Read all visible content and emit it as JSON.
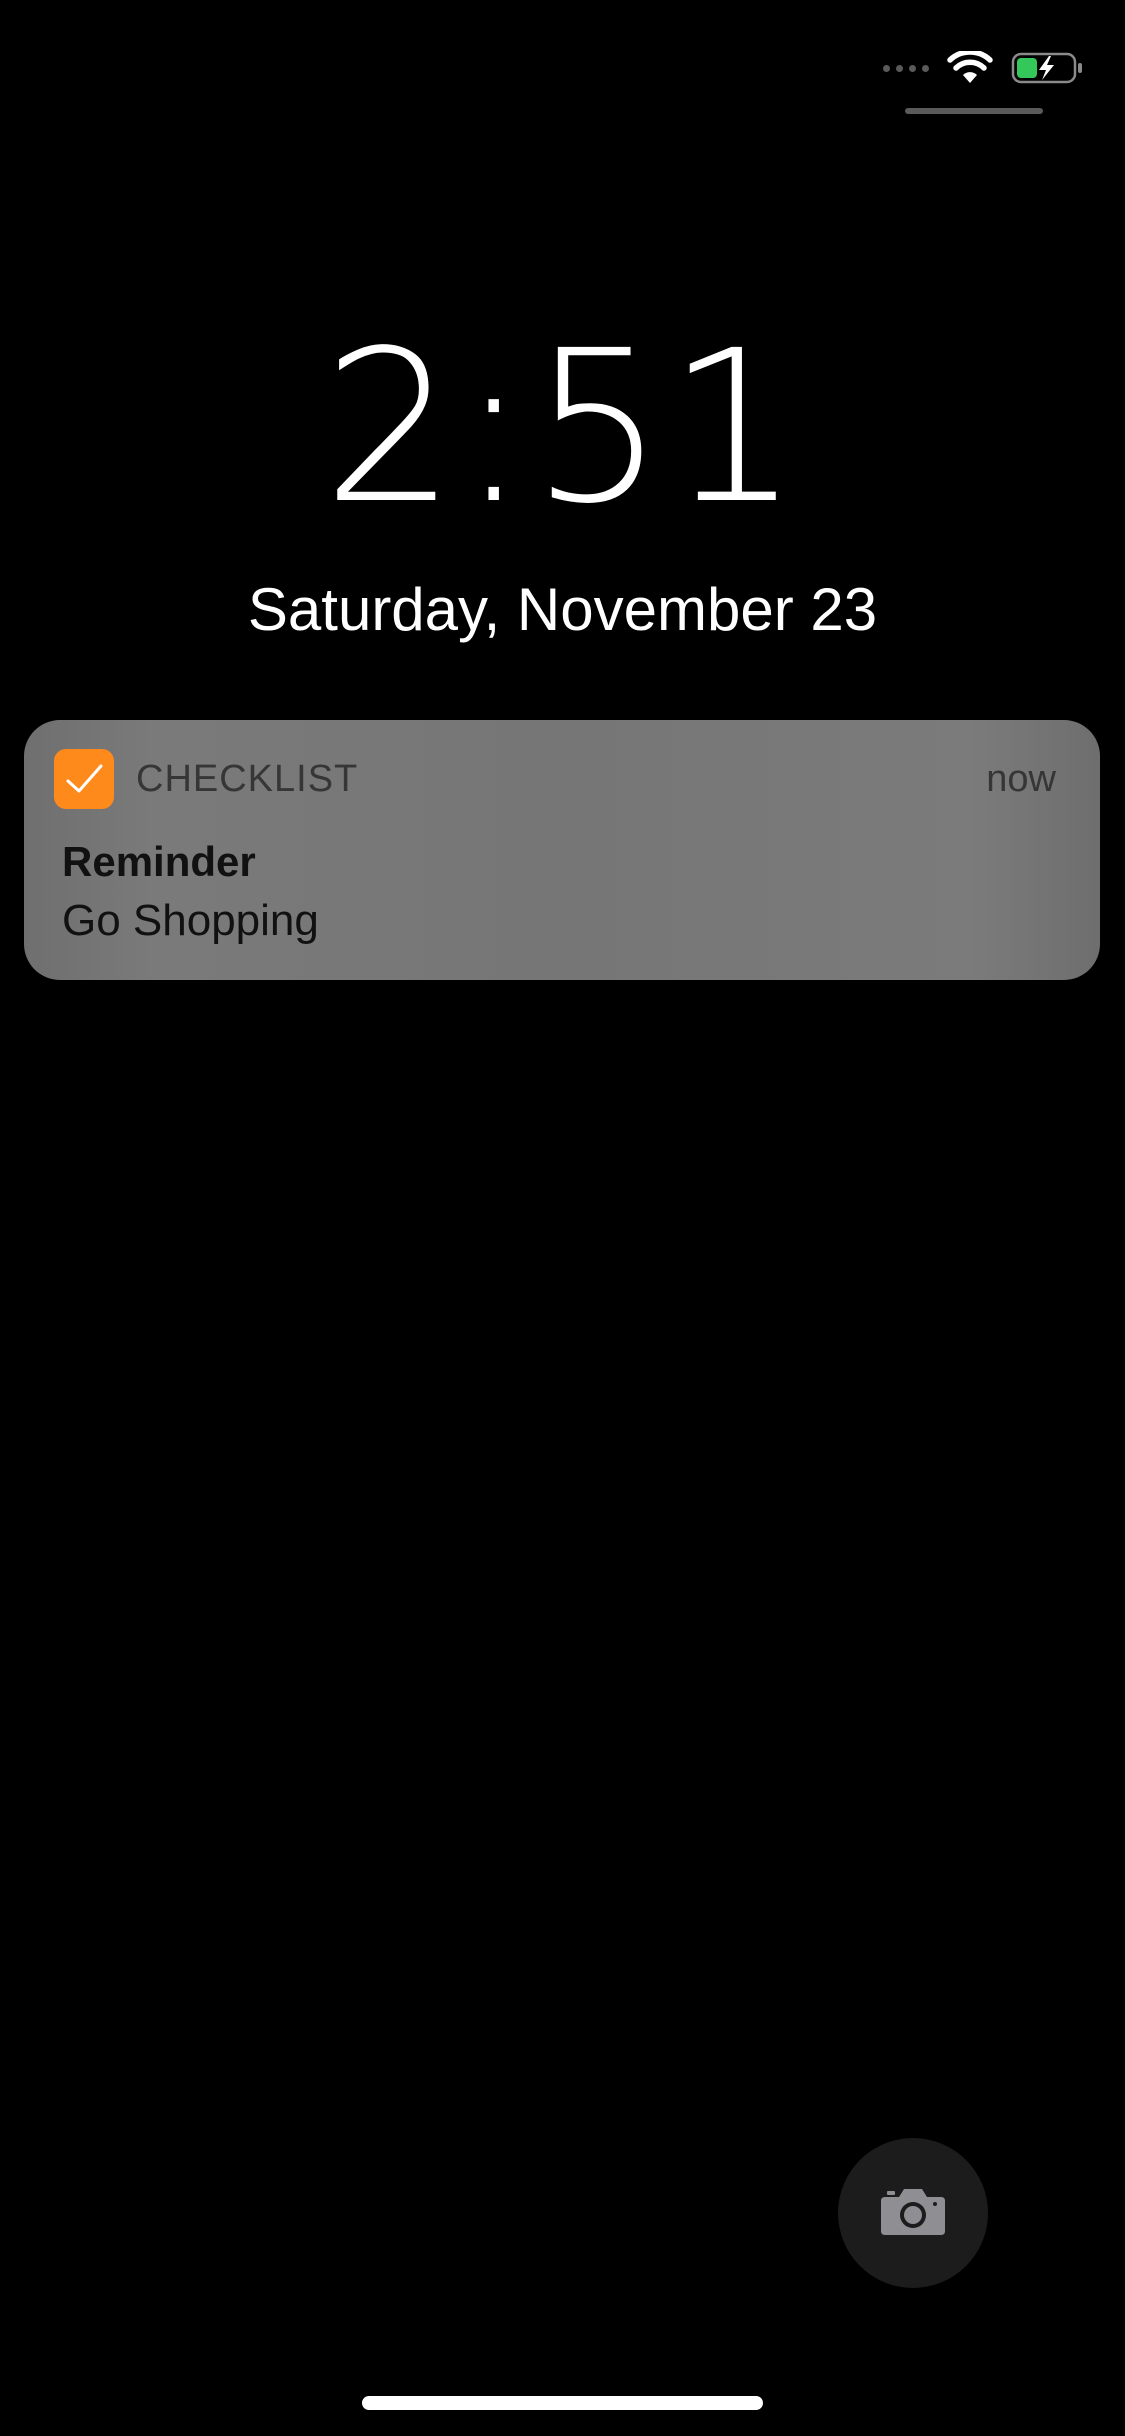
{
  "status_bar": {
    "signal_icon": "cellular-signal-icon",
    "wifi_icon": "wifi-icon",
    "battery_icon": "battery-charging-icon",
    "battery_color": "#34c759"
  },
  "lock_screen": {
    "time": "2:51",
    "date": "Saturday, November 23"
  },
  "notification": {
    "app_name": "CHECKLIST",
    "app_icon": "checkmark-icon",
    "app_color": "#ff8a1c",
    "time": "now",
    "title": "Reminder",
    "body": "Go Shopping"
  },
  "quick_actions": {
    "camera_icon": "camera-icon"
  }
}
